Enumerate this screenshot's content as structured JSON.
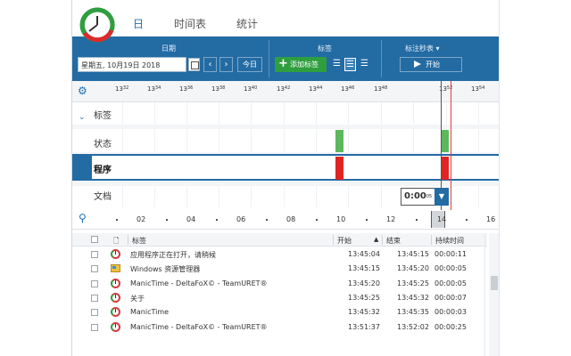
{
  "tabs": [
    {
      "label": "日"
    },
    {
      "label": "时间表"
    },
    {
      "label": "统计"
    }
  ],
  "toolbar": {
    "date_group_label": "日期",
    "date_value": "星期五, 10月19日 2018",
    "today_label": "今日",
    "tags_group_label": "标签",
    "add_tag_label": "添加标签",
    "stopwatch_group_label": "标注秒表 ▾",
    "start_label": "开始"
  },
  "ruler": {
    "ticks": [
      {
        "h": "13",
        "m": "32"
      },
      {
        "h": "13",
        "m": "34"
      },
      {
        "h": "13",
        "m": "36"
      },
      {
        "h": "13",
        "m": "38"
      },
      {
        "h": "13",
        "m": "40"
      },
      {
        "h": "13",
        "m": "42"
      },
      {
        "h": "13",
        "m": "44"
      },
      {
        "h": "13",
        "m": "46"
      },
      {
        "h": "13",
        "m": "48"
      },
      {
        "h": "13",
        "m": "52"
      },
      {
        "h": "13",
        "m": "54"
      }
    ]
  },
  "rows": {
    "tags": "标签",
    "status": "状态",
    "programs": "程序",
    "documents": "文档"
  },
  "time_display": {
    "main": "0:00",
    "sec": "05"
  },
  "overview": {
    "labels": [
      "02",
      "04",
      "06",
      "08",
      "10",
      "12",
      "14",
      "16"
    ]
  },
  "table": {
    "headers": {
      "tag": "标签",
      "start": "开始",
      "end": "结束",
      "duration": "持续时间"
    },
    "rows": [
      {
        "icon": "manictime-icon",
        "name": "应用程序正在打开，请稍候",
        "start": "13:45:04",
        "end": "13:45:15",
        "duration": "00:00:11"
      },
      {
        "icon": "explorer-icon",
        "name": "Windows 资源管理器",
        "start": "13:45:15",
        "end": "13:45:20",
        "duration": "00:00:05"
      },
      {
        "icon": "manictime-icon",
        "name": "ManicTime - DeltaFoX© - TeamURET®",
        "start": "13:45:20",
        "end": "13:45:25",
        "duration": "00:00:05"
      },
      {
        "icon": "manictime-icon",
        "name": "关于",
        "start": "13:45:25",
        "end": "13:45:32",
        "duration": "00:00:07"
      },
      {
        "icon": "manictime-icon",
        "name": "ManicTime",
        "start": "13:45:32",
        "end": "13:45:35",
        "duration": "00:00:03"
      },
      {
        "icon": "manictime-icon",
        "name": "ManicTime - DeltaFoX© - TeamURET®",
        "start": "13:51:37",
        "end": "13:52:02",
        "duration": "00:00:25"
      }
    ]
  },
  "colors": {
    "accent": "#236ba3",
    "active_green": "#5cb85c",
    "program_red": "#e02424"
  }
}
